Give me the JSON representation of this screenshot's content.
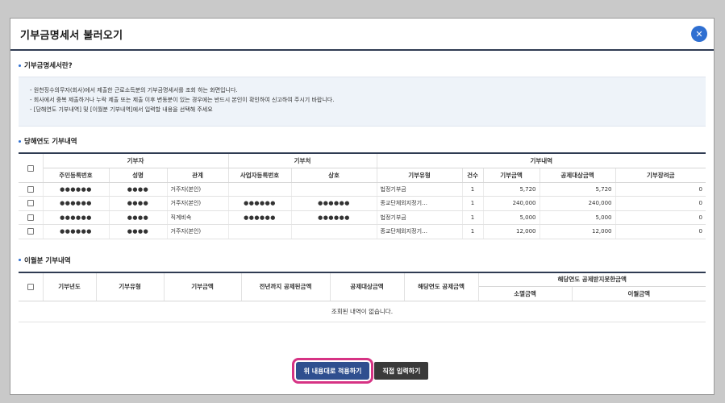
{
  "modal": {
    "title": "기부금명세서 불러오기",
    "close_icon": "close-icon"
  },
  "about": {
    "title": "기부금명세서란?",
    "lines": [
      "- 원천징수의무자(회사)에서 제출한 근로소득분의 기부금명세서를 조회 하는 화면입니다.",
      "- 회사에서 중복 제출하거나 누락 제출 또는 제출 이후 변동분이 있는 경우에는 반드시 본인이 확인하여 신고하여 주시기 바랍니다.",
      "- [당해연도 기부내역] 및 [이월분 기부내역]에서 입력할 내용을 선택해 주세요"
    ]
  },
  "current": {
    "title": "당해연도 기부내역",
    "group_headers": [
      "기부자",
      "기부처",
      "기부내역"
    ],
    "columns": [
      "주민등록번호",
      "성명",
      "관계",
      "사업자등록번호",
      "상호",
      "기부유형",
      "건수",
      "기부금액",
      "공제대상금액",
      "기부장려금"
    ],
    "rows": [
      {
        "rrn": "●●●●●●",
        "name": "●●●●",
        "relation": "거주자(본인)",
        "bizno": "",
        "company": "",
        "type": "법정기부금",
        "count": "1",
        "amount": "5,720",
        "deductible": "5,720",
        "incentive": "0"
      },
      {
        "rrn": "●●●●●●",
        "name": "●●●●",
        "relation": "거주자(본인)",
        "bizno": "●●●●●●",
        "company": "●●●●●●",
        "type": "종교단체외지정기…",
        "count": "1",
        "amount": "240,000",
        "deductible": "240,000",
        "incentive": "0"
      },
      {
        "rrn": "●●●●●●",
        "name": "●●●●",
        "relation": "직계비속",
        "bizno": "●●●●●●",
        "company": "●●●●●●",
        "type": "법정기부금",
        "count": "1",
        "amount": "5,000",
        "deductible": "5,000",
        "incentive": "0"
      },
      {
        "rrn": "●●●●●●",
        "name": "●●●●",
        "relation": "거주자(본인)",
        "bizno": "",
        "company": "",
        "type": "종교단체외지정기…",
        "count": "1",
        "amount": "12,000",
        "deductible": "12,000",
        "incentive": "0"
      }
    ]
  },
  "carryover": {
    "title": "이월분 기부내역",
    "columns": [
      "기부년도",
      "기부유형",
      "기부금액",
      "전년까지 공제된금액",
      "공제대상금액",
      "해당연도 공제금액"
    ],
    "group_header": "해당연도 공제받지못한금액",
    "sub_columns": [
      "소멸금액",
      "이월금액"
    ],
    "empty_message": "조회된 내역이 없습니다."
  },
  "buttons": {
    "apply": "위 내용대로 적용하기",
    "manual": "직접 입력하기"
  },
  "colors": {
    "header_rule": "#2f3b52",
    "accent_blue": "#2f6fd1",
    "highlight": "#d63384"
  }
}
